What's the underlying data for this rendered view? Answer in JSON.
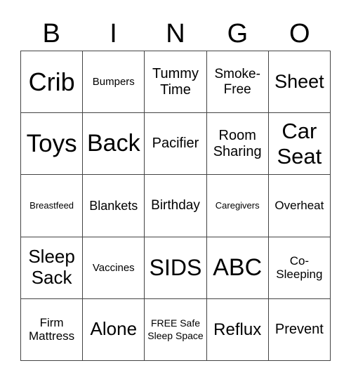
{
  "header": [
    "B",
    "I",
    "N",
    "G",
    "O"
  ],
  "cells": [
    {
      "text": "Crib",
      "size": 36
    },
    {
      "text": "Bumpers",
      "size": 15
    },
    {
      "text": "Tummy Time",
      "size": 20
    },
    {
      "text": "Smoke-Free",
      "size": 19
    },
    {
      "text": "Sheet",
      "size": 27
    },
    {
      "text": "Toys",
      "size": 35
    },
    {
      "text": "Back",
      "size": 34
    },
    {
      "text": "Pacifier",
      "size": 20
    },
    {
      "text": "Room Sharing",
      "size": 20
    },
    {
      "text": "Car Seat",
      "size": 31
    },
    {
      "text": "Breastfeed",
      "size": 13
    },
    {
      "text": "Blankets",
      "size": 18
    },
    {
      "text": "Birthday",
      "size": 19
    },
    {
      "text": "Caregivers",
      "size": 13
    },
    {
      "text": "Overheat",
      "size": 17
    },
    {
      "text": "Sleep Sack",
      "size": 26
    },
    {
      "text": "Vaccines",
      "size": 15
    },
    {
      "text": "SIDS",
      "size": 32
    },
    {
      "text": "ABC",
      "size": 34
    },
    {
      "text": "Co-Sleeping",
      "size": 17
    },
    {
      "text": "Firm Mattress",
      "size": 17
    },
    {
      "text": "Alone",
      "size": 26
    },
    {
      "text": "FREE Safe Sleep Space",
      "size": 14
    },
    {
      "text": "Reflux",
      "size": 24
    },
    {
      "text": "Prevent",
      "size": 20
    }
  ]
}
